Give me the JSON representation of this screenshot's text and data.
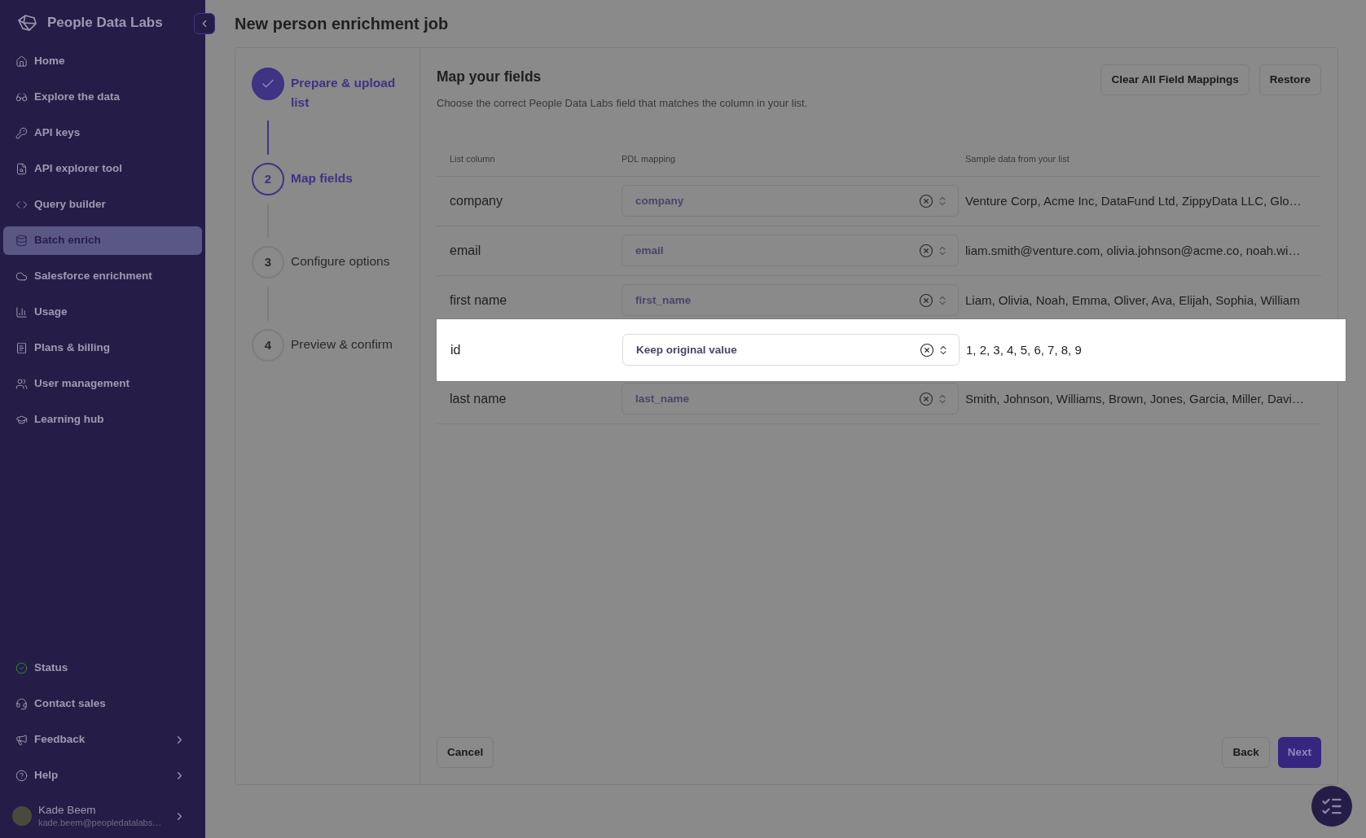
{
  "brand": {
    "name": "People Data Labs"
  },
  "nav": [
    {
      "label": "Home",
      "selected": false
    },
    {
      "label": "Explore the data",
      "selected": false
    },
    {
      "label": "API keys",
      "selected": false
    },
    {
      "label": "API explorer tool",
      "selected": false
    },
    {
      "label": "Query builder",
      "selected": false
    },
    {
      "label": "Batch enrich",
      "selected": true
    },
    {
      "label": "Salesforce enrichment",
      "selected": false
    },
    {
      "label": "Usage",
      "selected": false
    },
    {
      "label": "Plans & billing",
      "selected": false
    },
    {
      "label": "User management",
      "selected": false
    },
    {
      "label": "Learning hub",
      "selected": false
    }
  ],
  "nav_bottom": [
    {
      "label": "Status",
      "submenu": false
    },
    {
      "label": "Contact sales",
      "submenu": false
    },
    {
      "label": "Feedback",
      "submenu": true
    },
    {
      "label": "Help",
      "submenu": true
    }
  ],
  "user": {
    "name": "Kade Beem",
    "email": "kade.beem@peopledatalabs…"
  },
  "page_title": "New person enrichment job",
  "steps": [
    {
      "label": "Prepare & upload list",
      "completed": true,
      "selected": false
    },
    {
      "number": "2",
      "label": "Map fields",
      "completed": false,
      "selected": true
    },
    {
      "number": "3",
      "label": "Configure options",
      "completed": false,
      "selected": false
    },
    {
      "number": "4",
      "label": "Preview & confirm",
      "completed": false,
      "selected": false
    }
  ],
  "section": {
    "title": "Map your fields",
    "description": "Choose the correct People Data Labs field that matches the column in your list.",
    "actions": [
      "Clear All Field Mappings",
      "Restore"
    ]
  },
  "table": {
    "columns": [
      "List column",
      "PDL mapping",
      "Sample data from your list"
    ],
    "rows": [
      {
        "column": "company",
        "mapping": "company",
        "sample": "Venture Corp, Acme Inc, DataFund Ltd, ZippyData LLC, Glo…",
        "highlighted": false
      },
      {
        "column": "email",
        "mapping": "email",
        "sample": "liam.smith@venture.com, olivia.johnson@acme.co, noah.wi…",
        "highlighted": false
      },
      {
        "column": "first name",
        "mapping": "first_name",
        "sample": "Liam, Olivia, Noah, Emma, Oliver, Ava, Elijah, Sophia, William",
        "highlighted": false
      },
      {
        "column": "id",
        "mapping": "Keep original value",
        "sample": "1, 2, 3, 4, 5, 6, 7, 8, 9",
        "highlighted": true
      },
      {
        "column": "last name",
        "mapping": "last_name",
        "sample": "Smith, Johnson, Williams, Brown, Jones, Garcia, Miller, Davi…",
        "highlighted": false
      }
    ]
  },
  "footer": {
    "cancel": "Cancel",
    "back": "Back",
    "next": "Next"
  }
}
